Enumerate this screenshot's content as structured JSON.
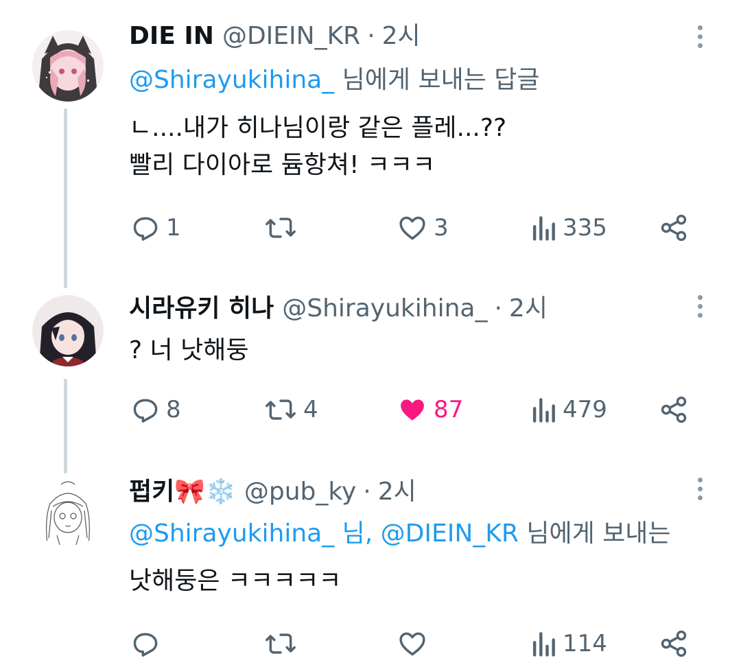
{
  "tweets": [
    {
      "name": "DIE IN",
      "handle": "@DIEIN_KR",
      "dot": "·",
      "time": "2시",
      "reply_mention": "@Shirayukihina_",
      "reply_suffix": " 님에게 보내는 답글",
      "lines": [
        "ㄴ....내가 히나님이랑 같은 플레...??",
        "빨리 다이아로 듐항쳐! ㅋㅋㅋ"
      ],
      "replies": "1",
      "retweets": "",
      "likes": "3",
      "liked": false,
      "views": "335"
    },
    {
      "name": "시라유키 히나",
      "handle": "@Shirayukihina_",
      "dot": "·",
      "time": "2시",
      "lines": [
        "? 너 낫해둥"
      ],
      "replies": "8",
      "retweets": "4",
      "likes": "87",
      "liked": true,
      "views": "479"
    },
    {
      "name": "펍키🎀❄️",
      "handle": "@pub_ky",
      "dot": "·",
      "time": "2시",
      "reply_mention_1": "@Shirayukihina_",
      "reply_sep": " 님, ",
      "reply_mention_2": "@DIEIN_KR",
      "reply_suffix": " 님에게 보내는",
      "lines": [
        "낫해둥은 ㅋㅋㅋㅋㅋ"
      ],
      "replies": "",
      "retweets": "",
      "likes": "",
      "liked": false,
      "views": "114"
    }
  ],
  "colors": {
    "accent": "#1d9bf0",
    "like_active": "#f91880",
    "secondary_text": "#536471",
    "thread_line": "#cfd9de"
  },
  "icons": [
    "reply-icon",
    "retweet-icon",
    "like-icon",
    "views-icon",
    "share-icon",
    "more-icon"
  ]
}
